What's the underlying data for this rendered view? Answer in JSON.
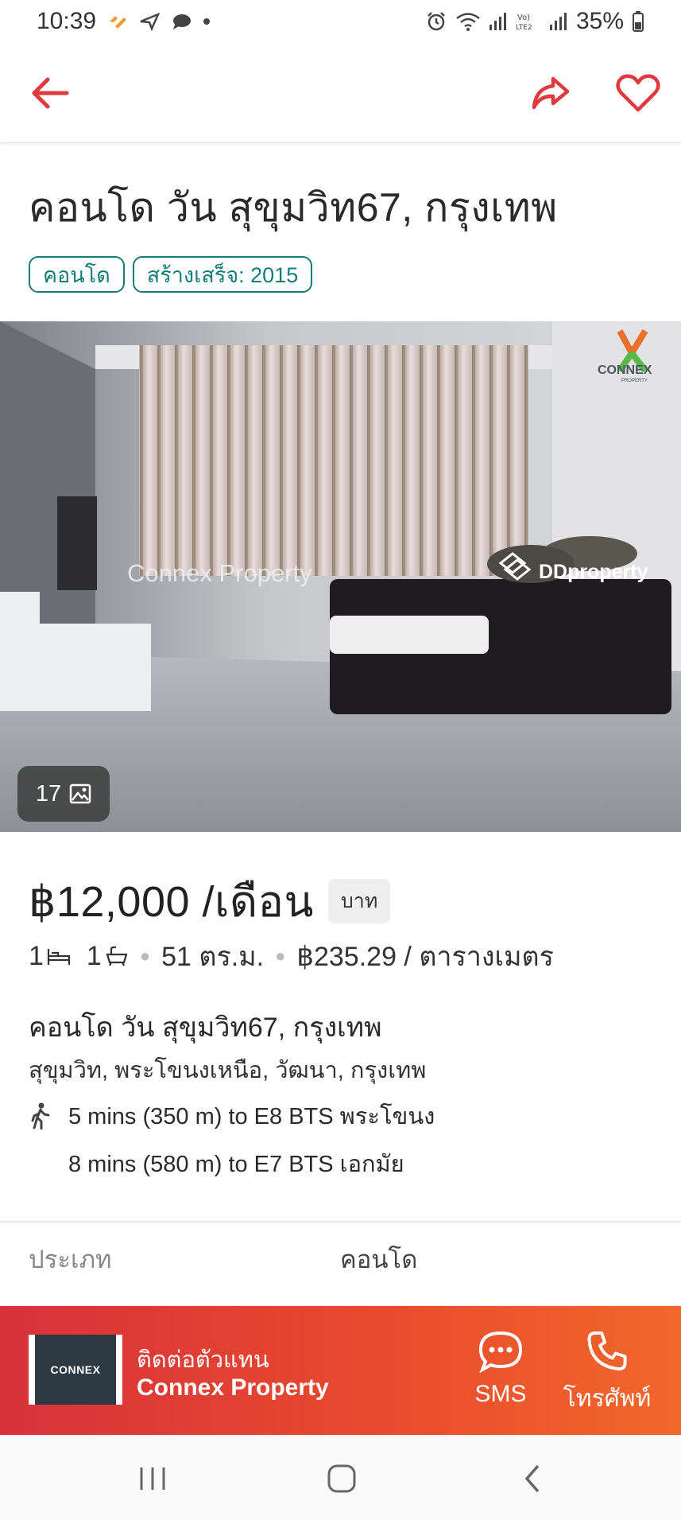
{
  "status_bar": {
    "time": "10:39",
    "battery": "35%"
  },
  "listing": {
    "title": "คอนโด วัน สุขุมวิท67, กรุงเทพ",
    "tags": [
      "คอนโด",
      "สร้างเสร็จ: 2015"
    ],
    "photo_count": "17",
    "photo_watermarks": {
      "brand": "CONNEX",
      "brand_sub": "PROPERTY",
      "overlay_text": "Connex Property",
      "portal": "DDproperty"
    },
    "price": "฿12,000 /เดือน",
    "currency": "บาท",
    "bedrooms": "1",
    "bathrooms": "1",
    "area": "51 ตร.ม.",
    "price_per_sqm": "฿235.29 / ตารางเมตร",
    "address_title": "คอนโด วัน สุขุมวิท67, กรุงเทพ",
    "address_sub": "สุขุมวิท, พระโขนงเหนือ, วัฒนา, กรุงเทพ",
    "transit": [
      "5 mins (350 m) to E8 BTS พระโขนง",
      "8 mins (580 m) to E7 BTS เอกมัย"
    ],
    "details": {
      "type_label": "ประเภท",
      "type_value": "คอนโด"
    }
  },
  "contact": {
    "label": "ติดต่อตัวแทน",
    "agent": "Connex Property",
    "logo_text": "CONNEX",
    "sms": "SMS",
    "call": "โทรศัพท์"
  },
  "colors": {
    "accent": "#e03a3e",
    "tag": "#157d77",
    "contact_gradient_start": "#d9313b",
    "contact_gradient_end": "#f2672a"
  },
  "icons": {
    "back": "arrow-left-icon",
    "share": "share-icon",
    "favorite": "heart-icon",
    "photos": "image-icon",
    "bed": "bed-icon",
    "bath": "bath-icon",
    "walk": "walk-icon",
    "sms": "chat-bubble-icon",
    "call": "phone-icon"
  }
}
